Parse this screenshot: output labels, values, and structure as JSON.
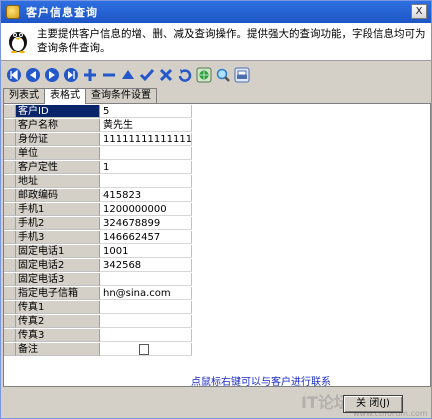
{
  "window": {
    "title": "客户信息查询",
    "close_label": "X"
  },
  "header": {
    "description": "主要提供客户信息的增、删、减及查询操作。提供强大的查询功能，字段信息均可为查询条件查询。"
  },
  "toolbar": {
    "buttons": [
      {
        "name": "first-record",
        "icon": "first-icon",
        "color": "#2457c9"
      },
      {
        "name": "prior-record",
        "icon": "prior-icon",
        "color": "#2457c9"
      },
      {
        "name": "next-record",
        "icon": "next-icon",
        "color": "#2457c9"
      },
      {
        "name": "last-record",
        "icon": "last-icon",
        "color": "#2457c9"
      },
      {
        "name": "insert",
        "icon": "plus-icon",
        "color": "#2457c9"
      },
      {
        "name": "delete",
        "icon": "minus-icon",
        "color": "#2457c9"
      },
      {
        "name": "edit",
        "icon": "up-triangle-icon",
        "color": "#2457c9"
      },
      {
        "name": "post",
        "icon": "check-icon",
        "color": "#2457c9"
      },
      {
        "name": "cancel",
        "icon": "x-icon",
        "color": "#2457c9"
      },
      {
        "name": "refresh",
        "icon": "refresh-icon",
        "color": "#2457c9"
      },
      {
        "name": "search",
        "icon": "search-globe-icon",
        "color": "#2a9e3c"
      },
      {
        "name": "find",
        "icon": "magnifier-icon",
        "color": "#2a7ec9"
      },
      {
        "name": "print",
        "icon": "print-icon",
        "color": "#4c6fb0"
      }
    ]
  },
  "tabs": [
    {
      "label": "列表式",
      "active": false
    },
    {
      "label": "表格式",
      "active": true
    },
    {
      "label": "查询条件设置",
      "active": false
    }
  ],
  "fields": [
    {
      "label": "客户ID",
      "value": "5",
      "selected": true
    },
    {
      "label": "客户名称",
      "value": "黄先生",
      "selected": false
    },
    {
      "label": "身份证",
      "value": "11111111111111111",
      "selected": false
    },
    {
      "label": "单位",
      "value": "",
      "selected": false
    },
    {
      "label": "客户定性",
      "value": "1",
      "selected": false
    },
    {
      "label": "地址",
      "value": "",
      "selected": false
    },
    {
      "label": "邮政编码",
      "value": "415823",
      "selected": false
    },
    {
      "label": "手机1",
      "value": "1200000000",
      "selected": false
    },
    {
      "label": "手机2",
      "value": "324678899",
      "selected": false
    },
    {
      "label": "手机3",
      "value": "146662457",
      "selected": false
    },
    {
      "label": "固定电话1",
      "value": "1001",
      "selected": false
    },
    {
      "label": "固定电话2",
      "value": "342568",
      "selected": false
    },
    {
      "label": "固定电话3",
      "value": "",
      "selected": false
    },
    {
      "label": "指定电子信箱",
      "value": "hn@sina.com",
      "selected": false
    },
    {
      "label": "传真1",
      "value": "",
      "selected": false
    },
    {
      "label": "传真2",
      "value": "",
      "selected": false
    },
    {
      "label": "传真3",
      "value": "",
      "selected": false
    },
    {
      "label": "备注",
      "value": "",
      "selected": false,
      "memo": true
    }
  ],
  "hint": "点鼠标右键可以与客户进行联系",
  "footer": {
    "close_button": "关 闭(J)",
    "watermark": "IT论坛",
    "watermark_url": "www.ctiforum.com"
  }
}
